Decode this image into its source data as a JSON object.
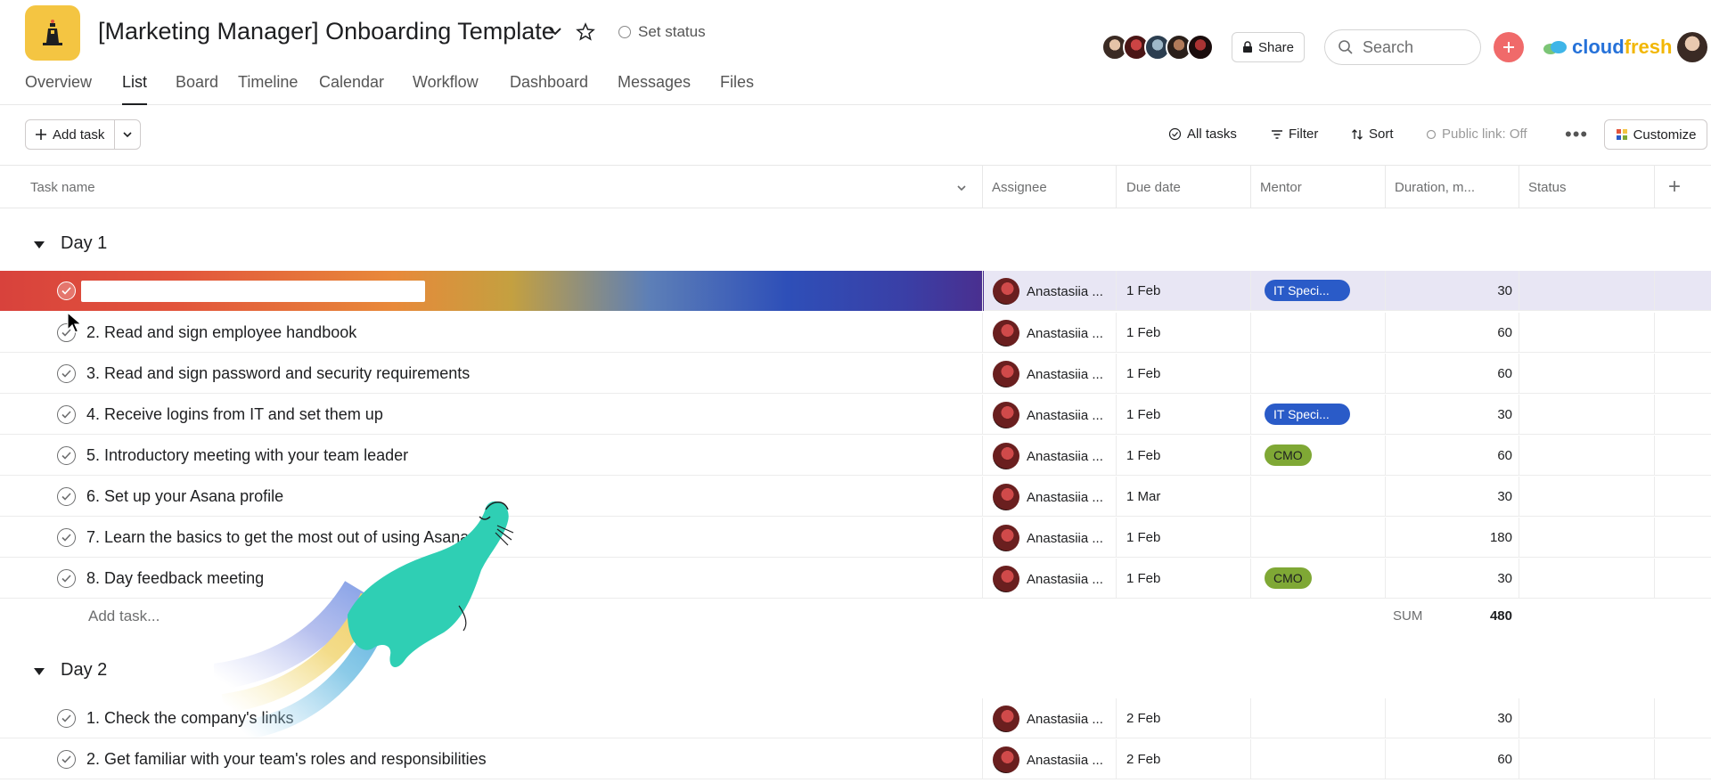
{
  "header": {
    "project_title": "[Marketing Manager] Onboarding Template",
    "set_status": "Set status",
    "share": "Share",
    "search_placeholder": "Search",
    "brand": {
      "part1": "cloud",
      "part2": "fresh"
    },
    "tabs": [
      "Overview",
      "List",
      "Board",
      "Timeline",
      "Calendar",
      "Workflow",
      "Dashboard",
      "Messages",
      "Files"
    ],
    "active_tab": "List"
  },
  "toolbar": {
    "add_task": "Add task",
    "all_tasks": "All tasks",
    "filter": "Filter",
    "sort": "Sort",
    "public_link": "Public link: Off",
    "customize": "Customize"
  },
  "columns": {
    "task_name": "Task name",
    "assignee": "Assignee",
    "due_date": "Due date",
    "mentor": "Mentor",
    "duration": "Duration, m...",
    "status": "Status"
  },
  "sections": [
    {
      "title": "Day 1",
      "rows": [
        {
          "name": "",
          "assignee": "Anastasiia ...",
          "due": "1 Feb",
          "mentor": "IT Speci...",
          "duration": "30"
        },
        {
          "name": "2. Read and sign employee handbook",
          "assignee": "Anastasiia ...",
          "due": "1 Feb",
          "mentor": "",
          "duration": "60"
        },
        {
          "name": "3. Read and sign password and security requirements",
          "assignee": "Anastasiia ...",
          "due": "1 Feb",
          "mentor": "",
          "duration": "60"
        },
        {
          "name": "4. Receive logins from IT and set them up",
          "assignee": "Anastasiia ...",
          "due": "1 Feb",
          "mentor": "IT Speci...",
          "duration": "30"
        },
        {
          "name": "5. Introductory meeting with your team leader",
          "assignee": "Anastasiia ...",
          "due": "1 Feb",
          "mentor": "CMO",
          "duration": "60"
        },
        {
          "name": "6. Set up your Asana profile",
          "assignee": "Anastasiia ...",
          "due": "1 Mar",
          "mentor": "",
          "duration": "30"
        },
        {
          "name": "7. Learn the basics to get the most out of using Asana",
          "assignee": "Anastasiia ...",
          "due": "1 Feb",
          "mentor": "",
          "duration": "180"
        },
        {
          "name": "8. Day feedback meeting",
          "assignee": "Anastasiia ...",
          "due": "1 Feb",
          "mentor": "CMO",
          "duration": "30"
        }
      ],
      "add_task": "Add task...",
      "sum_label": "SUM",
      "sum_value": "480"
    },
    {
      "title": "Day 2",
      "rows": [
        {
          "name": "1. Check the company's links",
          "assignee": "Anastasiia ...",
          "due": "2 Feb",
          "mentor": "",
          "duration": "30"
        },
        {
          "name": "2. Get familiar with your team's roles and responsibilities",
          "assignee": "Anastasiia ...",
          "due": "2 Feb",
          "mentor": "",
          "duration": "60"
        }
      ]
    }
  ],
  "colors": {
    "accent": "#f06a6a",
    "it_pill": "#2a5bc8",
    "cmo_pill": "#7fa835",
    "logo_bg": "#f4c542"
  }
}
